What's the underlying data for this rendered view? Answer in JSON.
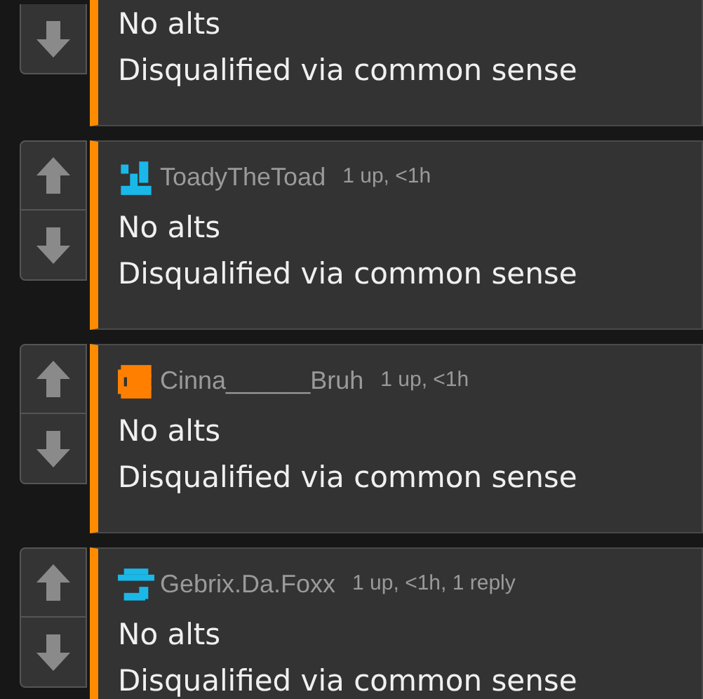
{
  "comments": [
    {
      "lines": [
        "No alts",
        "Disqualified via common sense"
      ]
    },
    {
      "avatar": {
        "color": "#1ab8e8"
      },
      "username": "ToadyTheToad",
      "meta": "1 up, <1h",
      "lines": [
        "No alts",
        "Disqualified via common sense"
      ]
    },
    {
      "avatar": {
        "color": "#ff8000"
      },
      "username": "Cinna______Bruh",
      "meta": "1 up, <1h",
      "lines": [
        "No alts",
        "Disqualified via common sense"
      ]
    },
    {
      "avatar": {
        "color": "#1ab8e8"
      },
      "username": "Gebrix.Da.Foxx",
      "meta": "1 up, <1h, 1 reply",
      "lines": [
        "No alts",
        "Disqualified via common sense"
      ]
    }
  ]
}
